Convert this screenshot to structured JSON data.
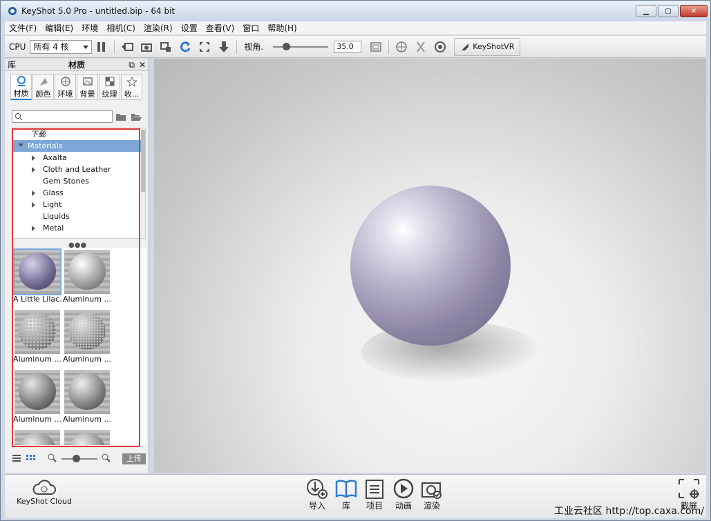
{
  "window": {
    "title": "KeyShot 5.0 Pro  - untitled.bip  - 64 bit"
  },
  "menu": [
    "文件(F)",
    "编辑(E)",
    "环境",
    "相机(C)",
    "渲染(R)",
    "设置",
    "查看(V)",
    "窗口",
    "帮助(H)"
  ],
  "toolbar": {
    "cpu_label": "CPU",
    "cpu_select": "所有 4 核",
    "fov_label": "视角.",
    "fov_value": "35.0",
    "fov_level": 0.2,
    "vr_label": "KeyShotVR"
  },
  "sidebar": {
    "library_label": "库",
    "header_title": "材质",
    "tabs": [
      "材质",
      "颜色",
      "环境",
      "背景",
      "纹理",
      "收..."
    ],
    "search_placeholder": "",
    "tree": {
      "download": "下载",
      "root": "Materials",
      "items": [
        "Axalta",
        "Cloth and Leather",
        "Gem Stones",
        "Glass",
        "Light",
        "Liquids",
        "Metal"
      ],
      "expandable": [
        true,
        true,
        false,
        true,
        true,
        false,
        true
      ]
    },
    "thumbnails": [
      "A Little Lilac...",
      "Aluminum ...",
      "Aluminum ...",
      "Aluminum ...",
      "Aluminum ...",
      "Aluminum ..."
    ],
    "upload_label": "上传"
  },
  "bottombar": {
    "cloud_label": "KeyShot Cloud",
    "nav": [
      "导入",
      "库",
      "项目",
      "动画",
      "渲染"
    ],
    "screenshot_label": "截屏",
    "watermark": "工业云社区 http://top.caxa.com/"
  },
  "colors": {
    "accent": "#2d7ad6",
    "selection": "#7ea6d6",
    "highlight_box": "#e03a3a",
    "sphere": "#9b95b3"
  }
}
